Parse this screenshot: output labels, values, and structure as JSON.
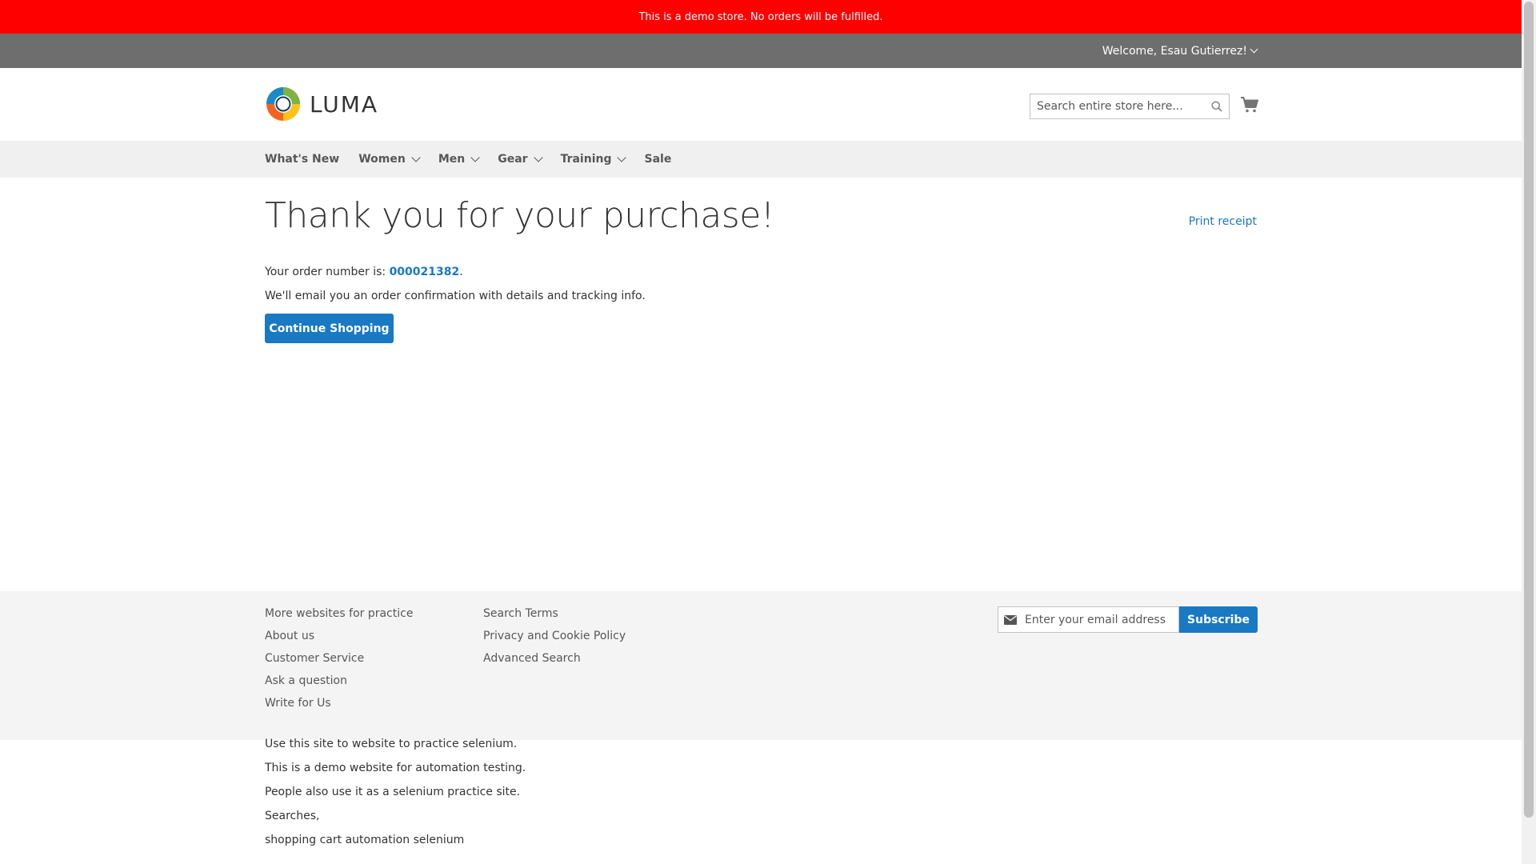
{
  "notice": {
    "text": "This is a demo store. No orders will be fulfilled."
  },
  "header": {
    "welcome": "Welcome, Esau Gutierrez!",
    "logo_text": "LUMA",
    "search_placeholder": "Search entire store here...",
    "icons": {
      "search": "search-icon",
      "cart": "cart-icon",
      "welcome_dropdown": "chevron-down-icon"
    }
  },
  "nav": {
    "items": [
      {
        "label": "What's New",
        "has_submenu": false
      },
      {
        "label": "Women",
        "has_submenu": true
      },
      {
        "label": "Men",
        "has_submenu": true
      },
      {
        "label": "Gear",
        "has_submenu": true
      },
      {
        "label": "Training",
        "has_submenu": true
      },
      {
        "label": "Sale",
        "has_submenu": false
      }
    ]
  },
  "main": {
    "title": "Thank you for your purchase!",
    "print_receipt": "Print receipt",
    "order_prefix": "Your order number is: ",
    "order_number": "000021382",
    "order_suffix": ".",
    "email_text": "We'll email you an order confirmation with details and tracking info.",
    "continue_button": "Continue Shopping"
  },
  "footer": {
    "col1": [
      "More websites for practice",
      "About us",
      "Customer Service",
      "Ask a question",
      "Write for Us"
    ],
    "col2": [
      "Search Terms",
      "Privacy and Cookie Policy",
      "Advanced Search"
    ],
    "newsletter_placeholder": "Enter your email address",
    "subscribe_button": "Subscribe",
    "newsletter_icon": "envelope-icon"
  },
  "bottom_text": [
    "Use this site to website to practice selenium.",
    "This is a demo website for automation testing.",
    "People also use it as a selenium practice site.",
    "Searches,",
    "shopping cart automation selenium"
  ],
  "colors": {
    "notice_bg": "#ff0000",
    "header_bar_bg": "#6e6e6e",
    "nav_bg": "#f0f0f0",
    "accent": "#1979c3",
    "footer_bg": "#f4f4f4"
  }
}
